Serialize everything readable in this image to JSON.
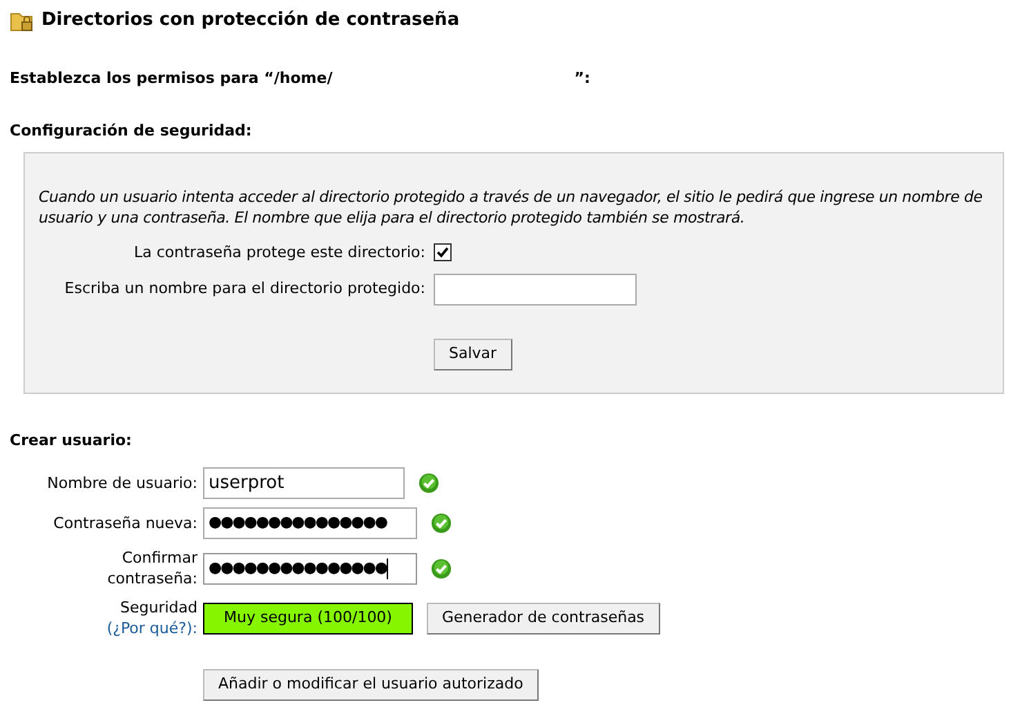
{
  "title": "Directorios con protección de contraseña",
  "permissions_heading": {
    "prefix": "Establezca los permisos para “/home/",
    "suffix": "”:"
  },
  "security": {
    "heading": "Configuración de seguridad:",
    "description": "Cuando un usuario intenta acceder al directorio protegido a través de un navegador, el sitio le pedirá que ingrese un nombre de usuario y una contraseña. El nombre que elija para el directorio protegido también se mostrará.",
    "protect_label": "La contraseña protege este directorio:",
    "protect_checked": true,
    "name_label": "Escriba un nombre para el directorio protegido:",
    "save_button": "Salvar"
  },
  "create_user": {
    "heading": "Crear usuario:",
    "fields": [
      {
        "label": "Nombre de usuario:",
        "value": "userprot",
        "valid": true,
        "focused": false
      },
      {
        "label": "Contraseña nueva:",
        "value": "●●●●●●●●●●●●●●●",
        "valid": true,
        "focused": false
      },
      {
        "label": "Confirmar contraseña:",
        "value": "●●●●●●●●●●●●●●●",
        "valid": true,
        "focused": true
      }
    ],
    "strength": {
      "label": "Seguridad",
      "link": "(¿Por qué?):",
      "reading": "Muy segura (100/100)",
      "level": 1
    },
    "generator_button": "Generador de contraseñas",
    "submit_button": "Añadir o modificar el usuario autorizado"
  }
}
